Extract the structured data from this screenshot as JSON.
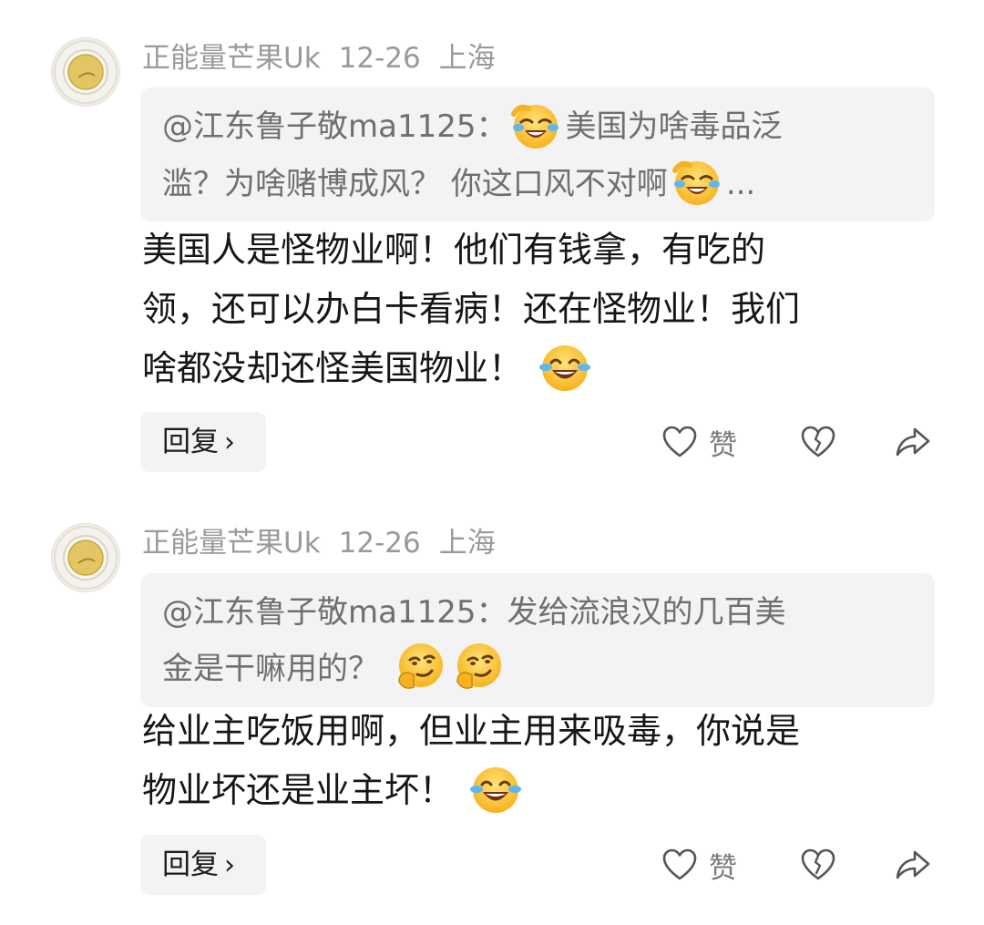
{
  "comments": [
    {
      "username": "正能量芒果Uk",
      "date": "12-26",
      "location": "上海",
      "quote": {
        "prefix": "@江东鲁子敬ma1125：",
        "text1": "美国为啥毒品泛",
        "text2": "滥？为啥赌博成风？ 你这口风不对啊",
        "ellipsis": "...",
        "emoji": "laughing-crying-emoji"
      },
      "body": {
        "line1": "美国人是怪物业啊！他们有钱拿，有吃的",
        "line2": "领，还可以办白卡看病！还在怪物业！我们",
        "line3": "啥都没却还怪美国物业！",
        "emoji": "tears-of-joy-emoji"
      },
      "reply_label": "回复",
      "like_label": "赞"
    },
    {
      "username": "正能量芒果Uk",
      "date": "12-26",
      "location": "上海",
      "quote": {
        "prefix": "@江东鲁子敬ma1125：",
        "text1": "发给流浪汉的几百美",
        "text2": "金是干嘛用的？",
        "emoji": "thinking-smirk-emoji"
      },
      "body": {
        "line1": "给业主吃饭用啊，但业主用来吸毒，你说是",
        "line2": "物业坏还是业主坏！",
        "emoji": "tears-of-joy-emoji"
      },
      "reply_label": "回复",
      "like_label": "赞"
    }
  ],
  "icons": {
    "reply_chevron": "chevron-right-icon",
    "like": "heart-outline-icon",
    "dislike": "broken-heart-icon",
    "share": "share-arrow-icon"
  },
  "colors": {
    "meta_gray": "#9a9a9a",
    "quote_bg": "#f3f3f5",
    "emoji_yellow": "#ffcc33"
  }
}
